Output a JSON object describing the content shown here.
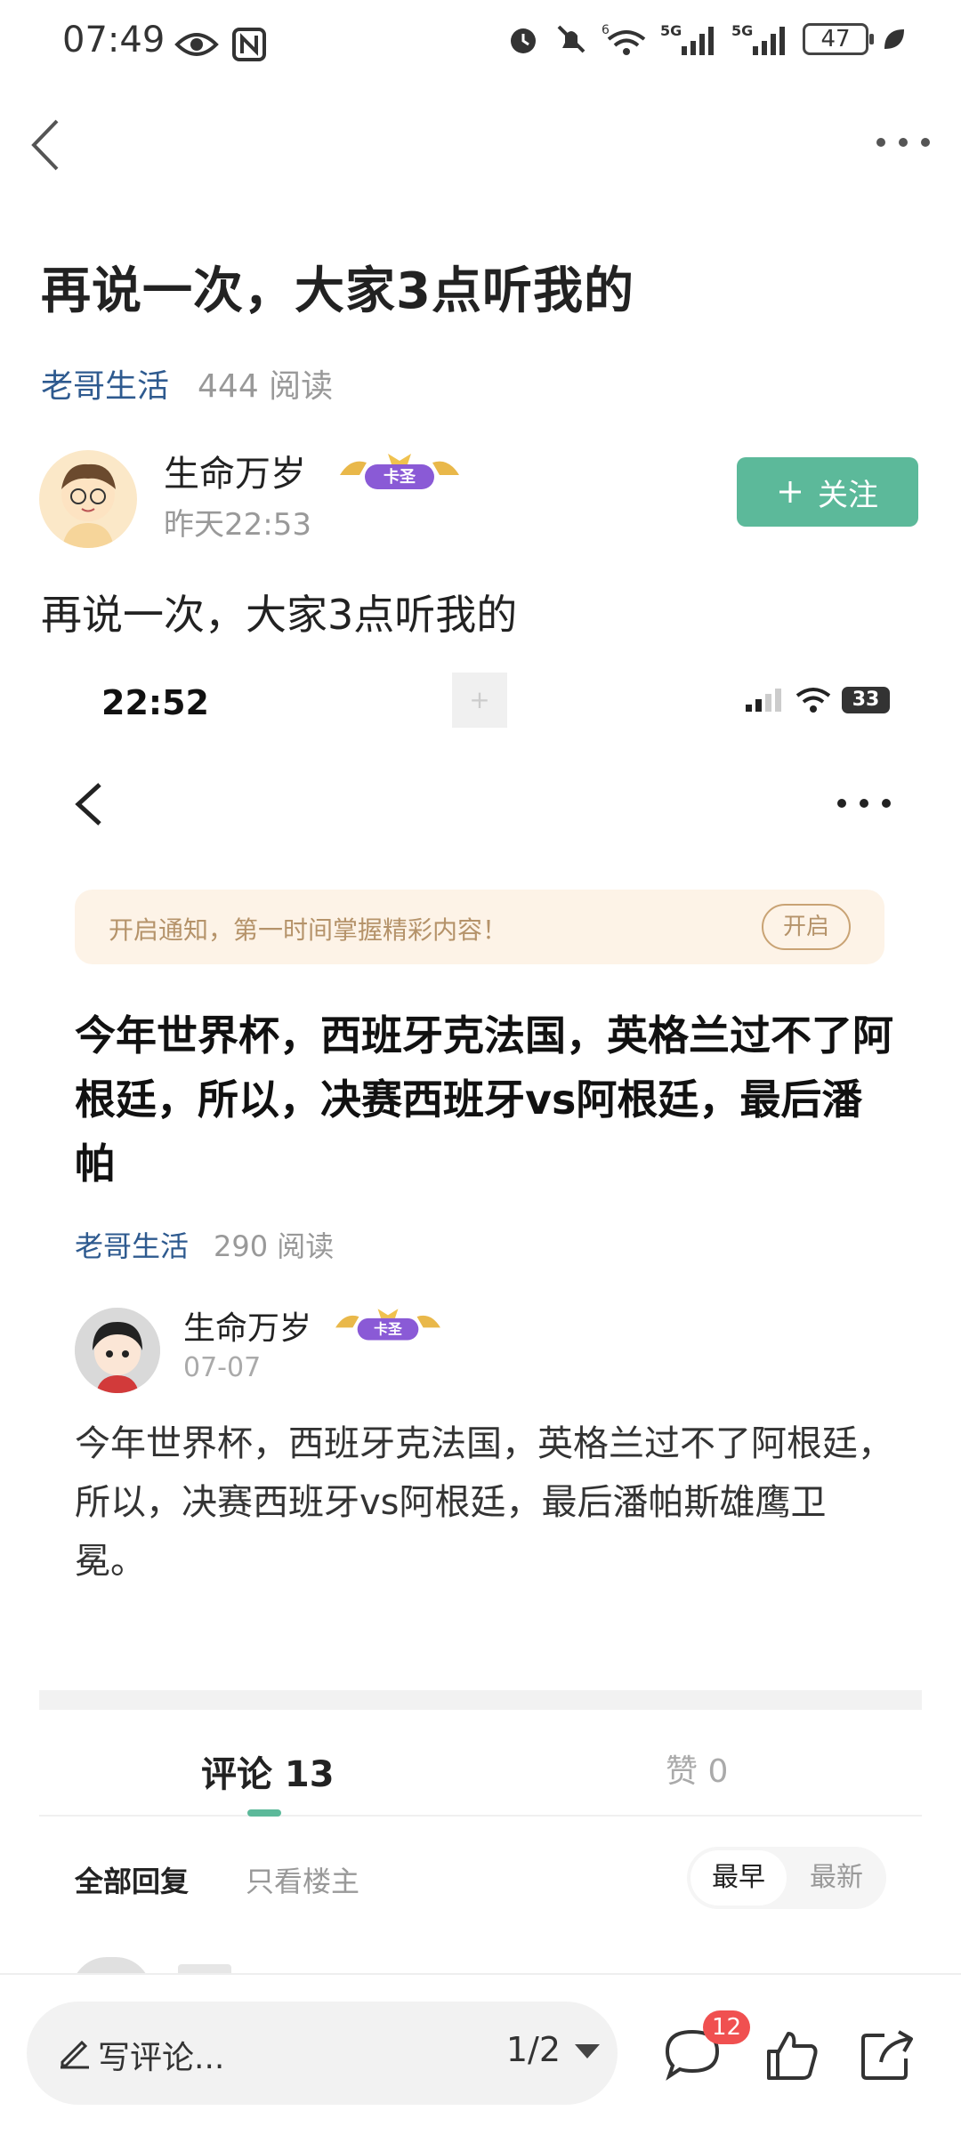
{
  "status_bar": {
    "time": "07:49",
    "network_5g_1": "5G",
    "network_5g_2": "5G",
    "wifi_label": "6",
    "battery": "47"
  },
  "nav": {
    "back_icon": "chevron-left-icon",
    "more_icon": "more-dots-icon"
  },
  "post": {
    "title": "再说一次，大家3点听我的",
    "channel": "老哥生活",
    "reads": "444 阅读",
    "author": {
      "name": "生命万岁",
      "badge": "卡圣",
      "time": "昨天22:53"
    },
    "follow_label": "关注",
    "body": "再说一次，大家3点听我的"
  },
  "embedded_screenshot": {
    "time": "22:52",
    "battery": "33",
    "notice": {
      "text": "开启通知，第一时间掌握精彩内容！",
      "button": "开启"
    },
    "title": "今年世界杯，西班牙克法国，英格兰过不了阿根廷，所以，决赛西班牙vs阿根廷，最后潘帕",
    "channel": "老哥生活",
    "reads": "290 阅读",
    "author": {
      "name": "生命万岁",
      "badge": "卡圣",
      "time": "07-07"
    },
    "body": "今年世界杯，西班牙克法国，英格兰过不了阿根廷，所以，决赛西班牙vs阿根廷，最后潘帕斯雄鹰卫冕。"
  },
  "tabs": {
    "comments": "评论 13",
    "likes": "赞 0"
  },
  "filter": {
    "all": "全部回复",
    "owner_only": "只看楼主",
    "sort_early": "最早",
    "sort_new": "最新"
  },
  "bottom_bar": {
    "comment_placeholder": "写评论...",
    "page": "1/2",
    "comment_count_badge": "12"
  },
  "colors": {
    "accent": "#5cb99a",
    "channel": "#2e5a8f",
    "badge_red": "#f05050"
  }
}
